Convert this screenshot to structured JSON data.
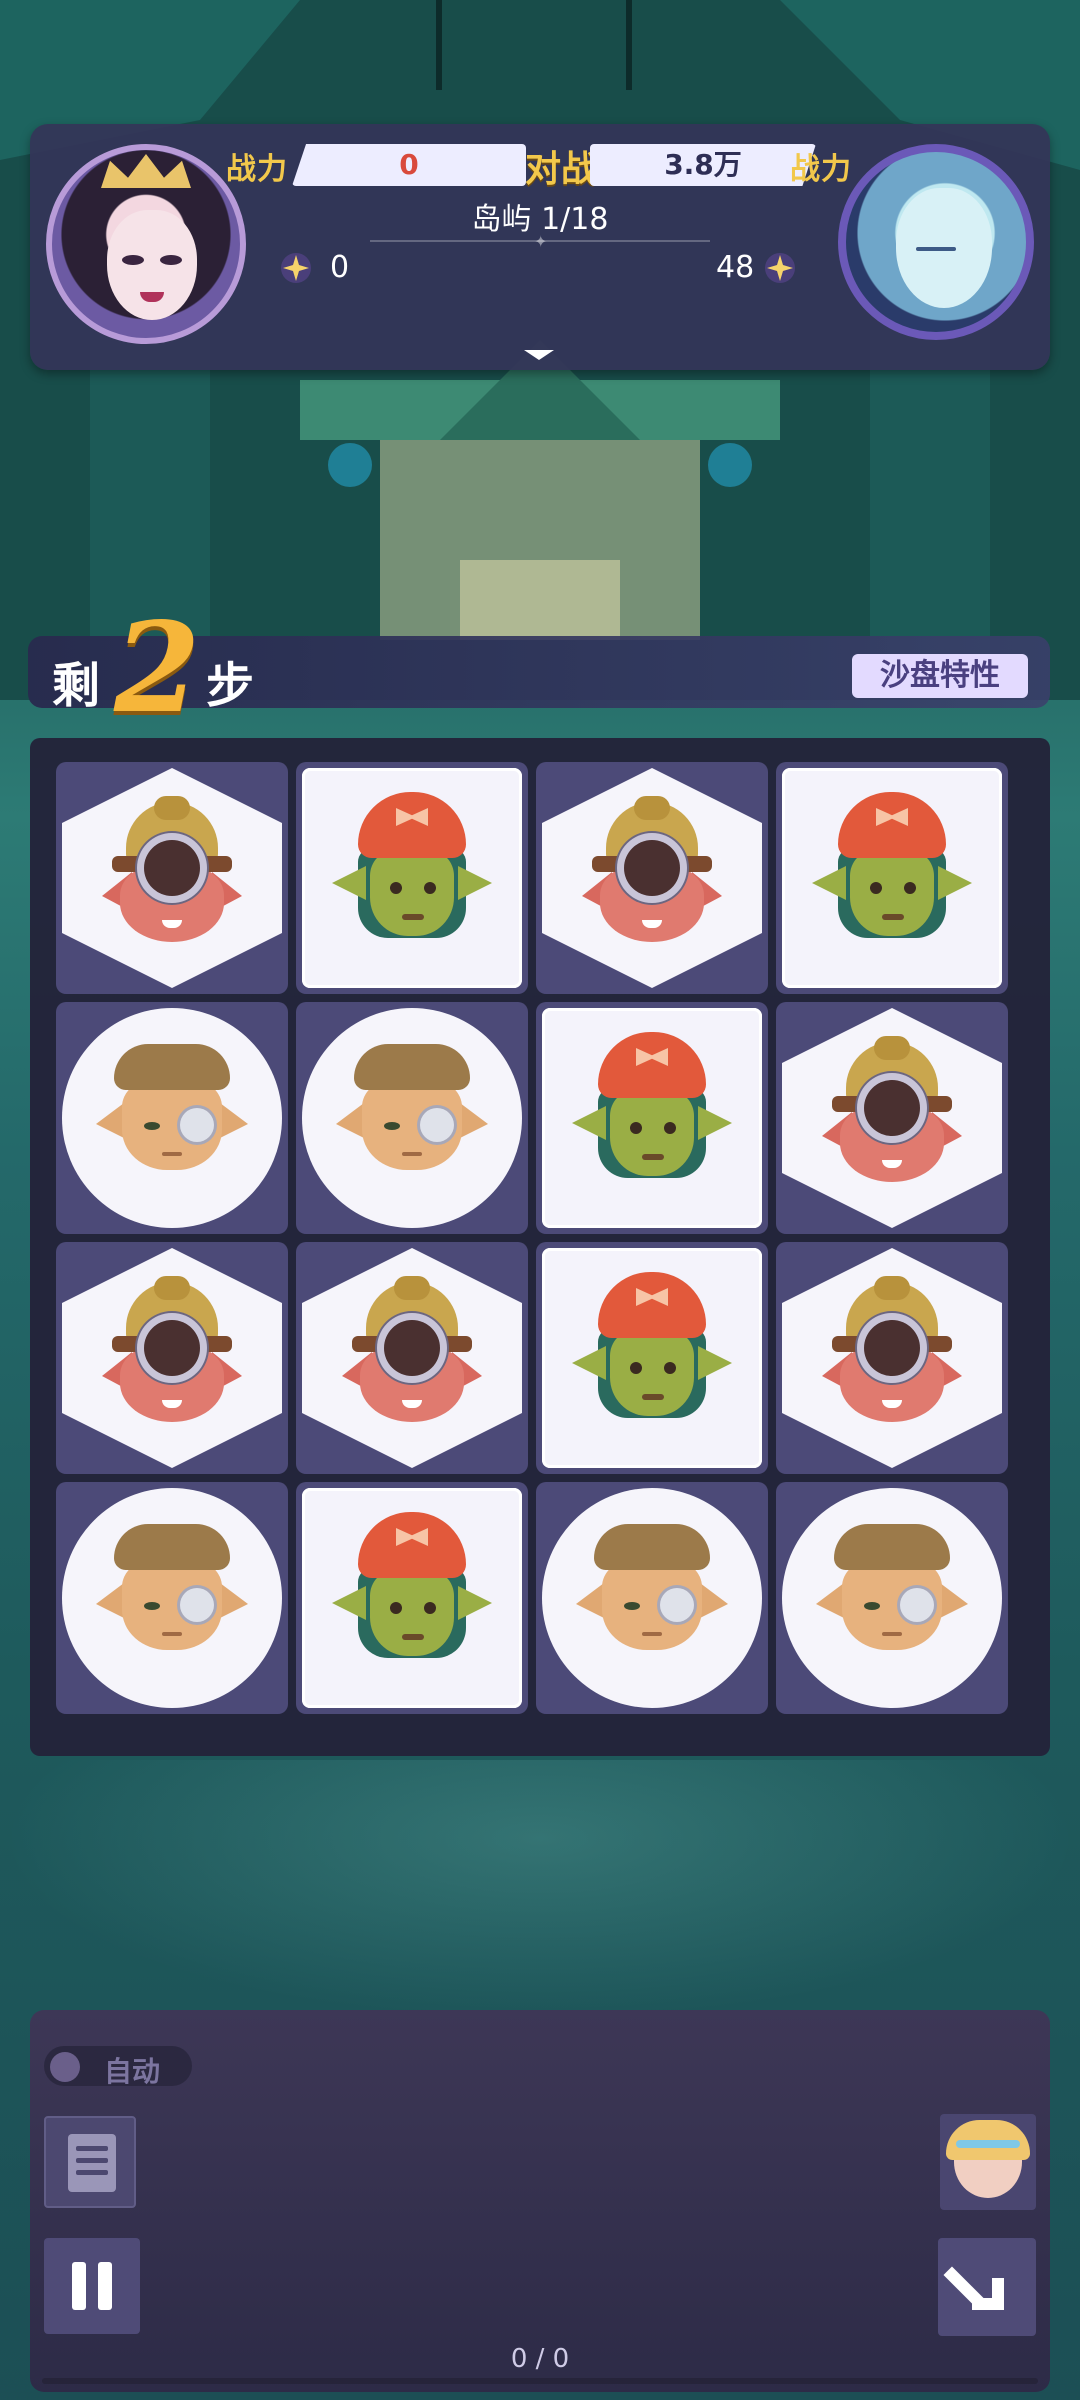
{
  "header": {
    "power_label_left": "战力",
    "power_value_left": "0",
    "vs_label": "对战",
    "power_value_right": "3.8万",
    "power_label_right": "战力",
    "island_progress": "岛屿 1/18",
    "gems_left": "0",
    "gems_right": "48",
    "colors": {
      "accent_gold": "#f2c84b",
      "power_left": "#d94a3c",
      "panel": "#343458"
    }
  },
  "steps": {
    "prefix": "剩",
    "count": "2",
    "suffix": "步",
    "sandbox_button": "沙盘特性"
  },
  "board": {
    "rows": 4,
    "cols": 4,
    "tiles": [
      [
        "miner-hex",
        "goblin-square",
        "miner-hex",
        "goblin-square"
      ],
      [
        "monocle-circle",
        "monocle-circle",
        "goblin-square",
        "miner-hex"
      ],
      [
        "miner-hex",
        "miner-hex",
        "goblin-square",
        "miner-hex"
      ],
      [
        "monocle-circle",
        "goblin-square",
        "monocle-circle",
        "monocle-circle"
      ]
    ]
  },
  "controls": {
    "auto_label": "自动",
    "auto_enabled": false,
    "battle_counter": "0 / 0",
    "icons": [
      "log-icon",
      "pause-icon",
      "hero-portrait-icon",
      "speed-arrow-icon"
    ]
  }
}
